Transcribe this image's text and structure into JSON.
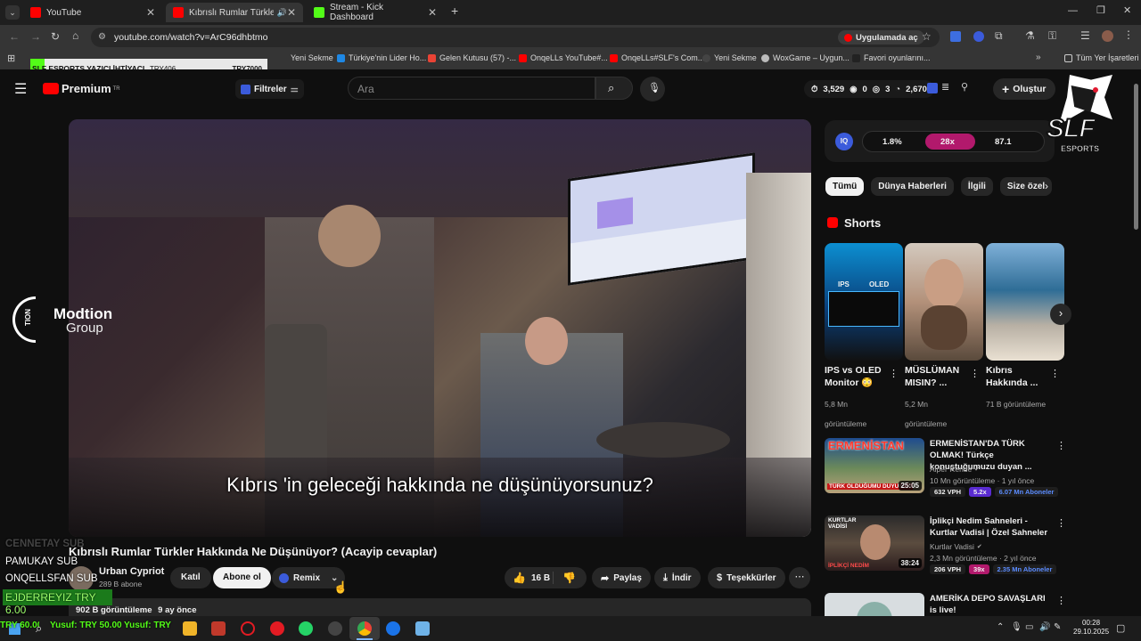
{
  "browser": {
    "tabs": [
      {
        "label": "YouTube",
        "color": "#ff0000"
      },
      {
        "label": "Kıbrıslı Rumlar Türkler Hakkı",
        "color": "#ff0000"
      },
      {
        "label": "Stream - Kick Dashboard",
        "color": "#53fc18"
      }
    ],
    "url": "youtube.com/watch?v=ArC96dhbtmo",
    "app_button": "Uygulamada aç",
    "bookmarks": [
      "Yeni Sekme",
      "Türkiye'nin Lider Ho...",
      "Gelen Kutusu (57) -...",
      "OnqeLLs YouTube#...",
      "OnqeLLs#SLF's Com...",
      "Yeni Sekme",
      "WoxGame – Uygun...",
      "Favori oyunlarını...",
      "Tüm Yer İşaretleri"
    ]
  },
  "overlay_top": {
    "title": "SLF ESPORTS YAZICI İHTİYACI",
    "left": "TRY406",
    "right": "TRY7000"
  },
  "yt": {
    "logo": "Premium",
    "logo_sup": "TR",
    "filters": "Filtreler",
    "search_placeholder": "Ara",
    "header_stats": [
      "3,529",
      "0",
      "3",
      "2,670"
    ],
    "create": "Oluştur"
  },
  "brand": {
    "name": "Modtion",
    "sub": "Group",
    "side": "TION"
  },
  "video": {
    "caption": "Kıbrıs 'in geleceği hakkında ne düşünüyorsunuz?",
    "title": "Kıbrıslı Rumlar Türkler Hakkında Ne Düşünüyor? (Acayip cevaplar)",
    "channel": "Urban Cypriot",
    "subs": "289 B abone",
    "join": "Katıl",
    "subscribe": "Abone ol",
    "remix": "Remix",
    "likes": "16 B",
    "share": "Paylaş",
    "download": "İndir",
    "thanks": "Teşekkürler",
    "views": "902 B görüntüleme",
    "age": "9 ay önce"
  },
  "iq_bar": {
    "a": "1.8%",
    "b": "28x",
    "c": "87.1"
  },
  "chips": [
    "Tümü",
    "Dünya Haberleri",
    "İlgili",
    "Size özel"
  ],
  "shorts": {
    "header": "Shorts",
    "items": [
      {
        "title": "IPS vs OLED Monitor 😳",
        "views": "5,8 Mn görüntüleme"
      },
      {
        "title": "MÜSLÜMAN MISIN? ...",
        "views": "5,2 Mn görüntüleme"
      },
      {
        "title": "Kıbrıs Hakkında ...",
        "views": "71 B görüntüleme"
      }
    ],
    "thumb_text": [
      "IPS",
      "OLED"
    ]
  },
  "recs": [
    {
      "thumb": "ERMENİSTAN",
      "thumb_sub": "TÜRK OLDUĞUMU DUYUNCA",
      "title": "ERMENİSTAN'DA TÜRK OLMAK! Türkçe konuştuğumuzu duyan ...",
      "channel": "Alper Rende",
      "meta": "10 Mn görüntüleme · 1 yıl önce",
      "vph": "632 VPH",
      "mult": "5.2x",
      "subs": "6.07 Mn Aboneler",
      "dur": "25:05"
    },
    {
      "thumb": "KURTLAR VADİSİ",
      "thumb_sub": "İPLİKÇİ NEDİM",
      "title": "İplikçi Nedim Sahneleri - Kurtlar Vadisi | Özel Sahneler",
      "channel": "Kurtlar Vadisi",
      "meta": "2,3 Mn görüntüleme · 2 yıl önce",
      "vph": "206 VPH",
      "mult": "39x",
      "subs": "2.35 Mn Aboneler",
      "dur": "38:24"
    },
    {
      "title": "AMERİKA DEPO SAVAŞLARI is live!"
    }
  ],
  "stream_overlay": {
    "lines": [
      "CENNETAY SUB",
      "PAMUKAY SUB",
      "ONQELLSFAN SUB"
    ],
    "highlight": "EJDERREYIZ TRY 6.00",
    "ticker": [
      "TRY 60.00",
      "Yusuf: TRY 50.00",
      "Yusuf: TRY"
    ]
  },
  "slf": {
    "name": "SLF",
    "sub": "ESPORTS"
  },
  "taskbar": {
    "time": "00:28",
    "date": "29.10.2025"
  }
}
